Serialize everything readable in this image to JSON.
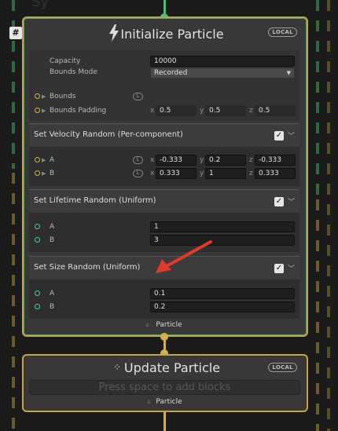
{
  "colors": {
    "flow_gold": "#c8a24a",
    "flow_green": "#3ec76e",
    "port_gold": "#d4b04c",
    "port_cyan": "#4fc3c3",
    "arrow_red": "#e03a2a"
  },
  "faded_title": "Sy",
  "hash_badge": "#",
  "initialize": {
    "title": "Initialize Particle",
    "badge": "LOCAL",
    "bolt_icon": "lightning-bolt",
    "capacity_label": "Capacity",
    "capacity_value": "10000",
    "bounds_mode_label": "Bounds Mode",
    "bounds_mode_value": "Recorded",
    "bounds_label": "Bounds",
    "bounds_chip": "L",
    "bounds_padding_label": "Bounds Padding",
    "bounds_padding": {
      "x_axis": "x",
      "x": "0.5",
      "y_axis": "y",
      "y": "0.5",
      "z_axis": "z",
      "z": "0.5"
    },
    "output_label": "Particle"
  },
  "velocity_block": {
    "title": "Set Velocity Random (Per-component)",
    "a_label": "A",
    "a_chip": "L",
    "a": {
      "x_axis": "x",
      "x": "-0.333",
      "y_axis": "y",
      "y": "0.2",
      "z_axis": "z",
      "z": "-0.333"
    },
    "b_label": "B",
    "b_chip": "L",
    "b": {
      "x_axis": "x",
      "x": "0.333",
      "y_axis": "y",
      "y": "1",
      "z_axis": "z",
      "z": "0.333"
    }
  },
  "lifetime_block": {
    "title": "Set Lifetime Random (Uniform)",
    "a_label": "A",
    "a_value": "1",
    "b_label": "B",
    "b_value": "3"
  },
  "size_block": {
    "title": "Set Size Random (Uniform)",
    "a_label": "A",
    "a_value": "0.1",
    "b_label": "B",
    "b_value": "0.2"
  },
  "update": {
    "title": "Update Particle",
    "badge": "LOCAL",
    "placeholder": "Press space to add blocks",
    "output_label": "Particle"
  }
}
